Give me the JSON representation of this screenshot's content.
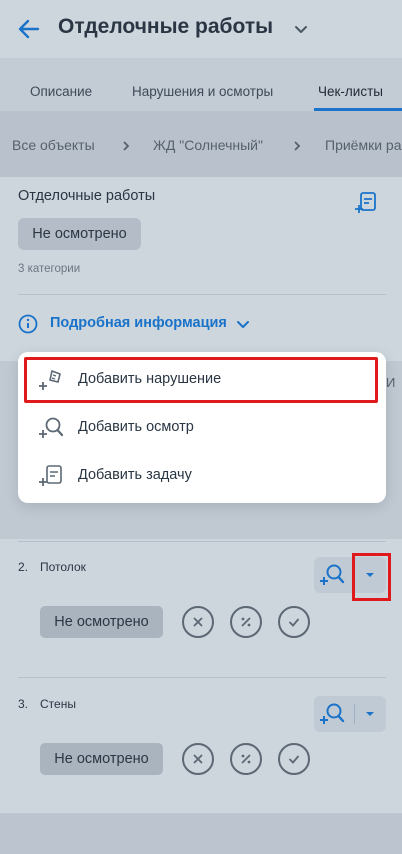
{
  "header": {
    "title": "Отделочные работы",
    "back_icon": "arrow-left-icon",
    "dropdown_icon": "chevron-down-icon"
  },
  "tabs": [
    {
      "label": "Описание"
    },
    {
      "label": "Нарушения и осмотры"
    },
    {
      "label": "Чек-листы",
      "active": true
    }
  ],
  "breadcrumbs": [
    {
      "label": "Все объекты"
    },
    {
      "label": "ЖД \"Солнечный\""
    },
    {
      "label": "Приёмки ра"
    }
  ],
  "section": {
    "title": "Отделочные работы",
    "status": "Не осмотрено",
    "categories_count": "3 категории",
    "info_label": "Подробная информация",
    "behind_text": "И"
  },
  "items": [
    {
      "number": "2.",
      "label": "Потолок",
      "status": "Не осмотрено"
    },
    {
      "number": "3.",
      "label": "Стены",
      "status": "Не осмотрено"
    }
  ],
  "menu": {
    "items": [
      {
        "label": "Добавить нарушение",
        "icon": "add-violation-icon"
      },
      {
        "label": "Добавить осмотр",
        "icon": "add-inspection-icon"
      },
      {
        "label": "Добавить задачу",
        "icon": "add-task-icon"
      }
    ]
  },
  "colors": {
    "accent": "#1a73c9",
    "highlight": "#e0191c"
  }
}
